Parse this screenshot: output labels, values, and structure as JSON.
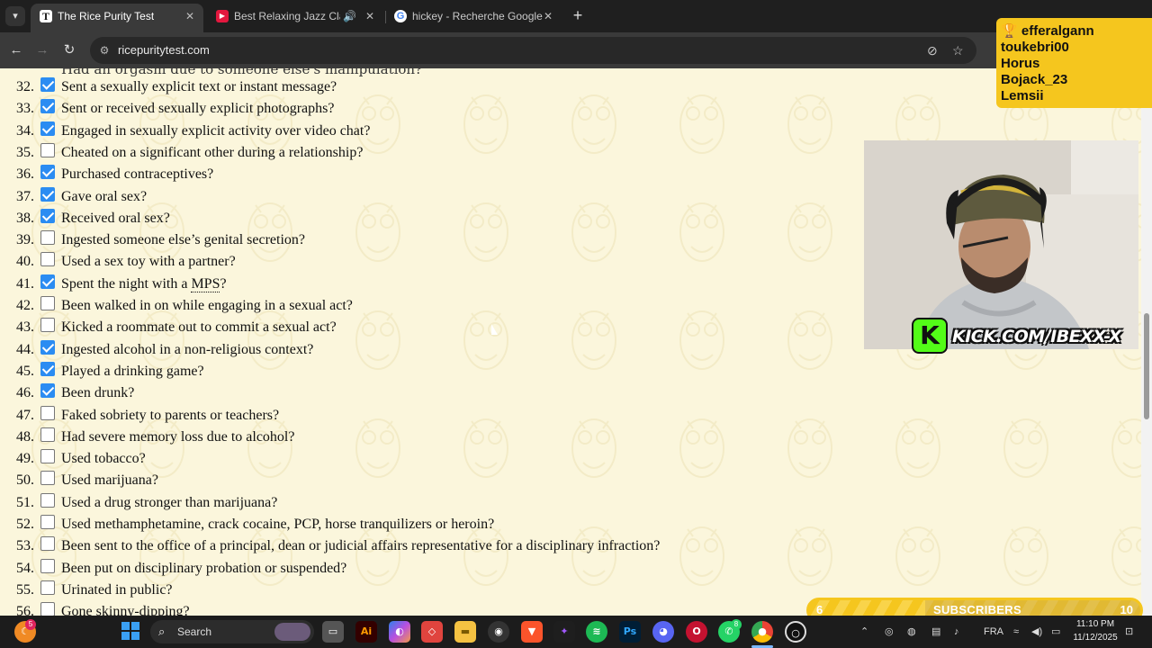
{
  "browser": {
    "tabs": [
      {
        "title": "The Rice Purity Test",
        "favicon_text": "T",
        "active": true
      },
      {
        "title": "Best Relaxing Jazz Classics :",
        "favicon_text": "▶",
        "active": false
      },
      {
        "title": "hickey - Recherche Google",
        "favicon_text": "G",
        "active": false
      }
    ],
    "url": "ricepuritytest.com"
  },
  "page": {
    "cut_text": "Had an orgasm due to someone else's manipulation?",
    "questions": [
      {
        "num": "32.",
        "text": "Sent a sexually explicit text or instant message?",
        "checked": true
      },
      {
        "num": "33.",
        "text": "Sent or received sexually explicit photographs?",
        "checked": true
      },
      {
        "num": "34.",
        "text": "Engaged in sexually explicit activity over video chat?",
        "checked": true
      },
      {
        "num": "35.",
        "text": "Cheated on a significant other during a relationship?",
        "checked": false
      },
      {
        "num": "36.",
        "text": "Purchased contraceptives?",
        "checked": true
      },
      {
        "num": "37.",
        "text": "Gave oral sex?",
        "checked": true
      },
      {
        "num": "38.",
        "text": "Received oral sex?",
        "checked": true
      },
      {
        "num": "39.",
        "text": "Ingested someone else’s genital secretion?",
        "checked": false
      },
      {
        "num": "40.",
        "text": "Used a sex toy with a partner?",
        "checked": false
      },
      {
        "num": "41.",
        "text_before": "Spent the night with a ",
        "abbr": "MPS",
        "text_after": "?",
        "checked": true
      },
      {
        "num": "42.",
        "text": "Been walked in on while engaging in a sexual act?",
        "checked": false
      },
      {
        "num": "43.",
        "text": "Kicked a roommate out to commit a sexual act?",
        "checked": false
      },
      {
        "num": "44.",
        "text": "Ingested alcohol in a non-religious context?",
        "checked": true
      },
      {
        "num": "45.",
        "text": "Played a drinking game?",
        "checked": true
      },
      {
        "num": "46.",
        "text": "Been drunk?",
        "checked": true
      },
      {
        "num": "47.",
        "text": "Faked sobriety to parents or teachers?",
        "checked": false
      },
      {
        "num": "48.",
        "text": "Had severe memory loss due to alcohol?",
        "checked": false
      },
      {
        "num": "49.",
        "text": "Used tobacco?",
        "checked": false
      },
      {
        "num": "50.",
        "text": "Used marijuana?",
        "checked": false
      },
      {
        "num": "51.",
        "text": "Used a drug stronger than marijuana?",
        "checked": false
      },
      {
        "num": "52.",
        "text": "Used methamphetamine, crack cocaine, PCP, horse tranquilizers or heroin?",
        "checked": false
      },
      {
        "num": "53.",
        "text": "Been sent to the office of a principal, dean or judicial affairs representative for a disciplinary infraction?",
        "checked": false
      },
      {
        "num": "54.",
        "text": "Been put on disciplinary probation or suspended?",
        "checked": false
      },
      {
        "num": "55.",
        "text": "Urinated in public?",
        "checked": false
      },
      {
        "num": "56.",
        "text": "Gone skinny-dipping?",
        "checked": false
      }
    ]
  },
  "stream": {
    "chat_users": [
      "efferalgann",
      "toukebri00",
      "Horus",
      "Bojack_23",
      "Lemsii"
    ],
    "chat_icon": "trophy-icon",
    "kick_logo_text": "K",
    "kick_url": "KICK.COM/IBEXX-X",
    "subs_current": "6",
    "subs_label": "SUBSCRIBERS",
    "subs_goal": "10",
    "subs_progress": 0.6
  },
  "taskbar": {
    "search_label": "Search",
    "language": "FRA",
    "time": "11:10 PM",
    "date": "11/12/2025",
    "badges": {
      "weather": "5",
      "whatsapp": "8"
    }
  },
  "colors": {
    "page_bg": "#fbf6dc",
    "checkbox_checked": "#2b8cf2",
    "chat_bg": "#f5c61e",
    "kick_green": "#53fc18"
  }
}
